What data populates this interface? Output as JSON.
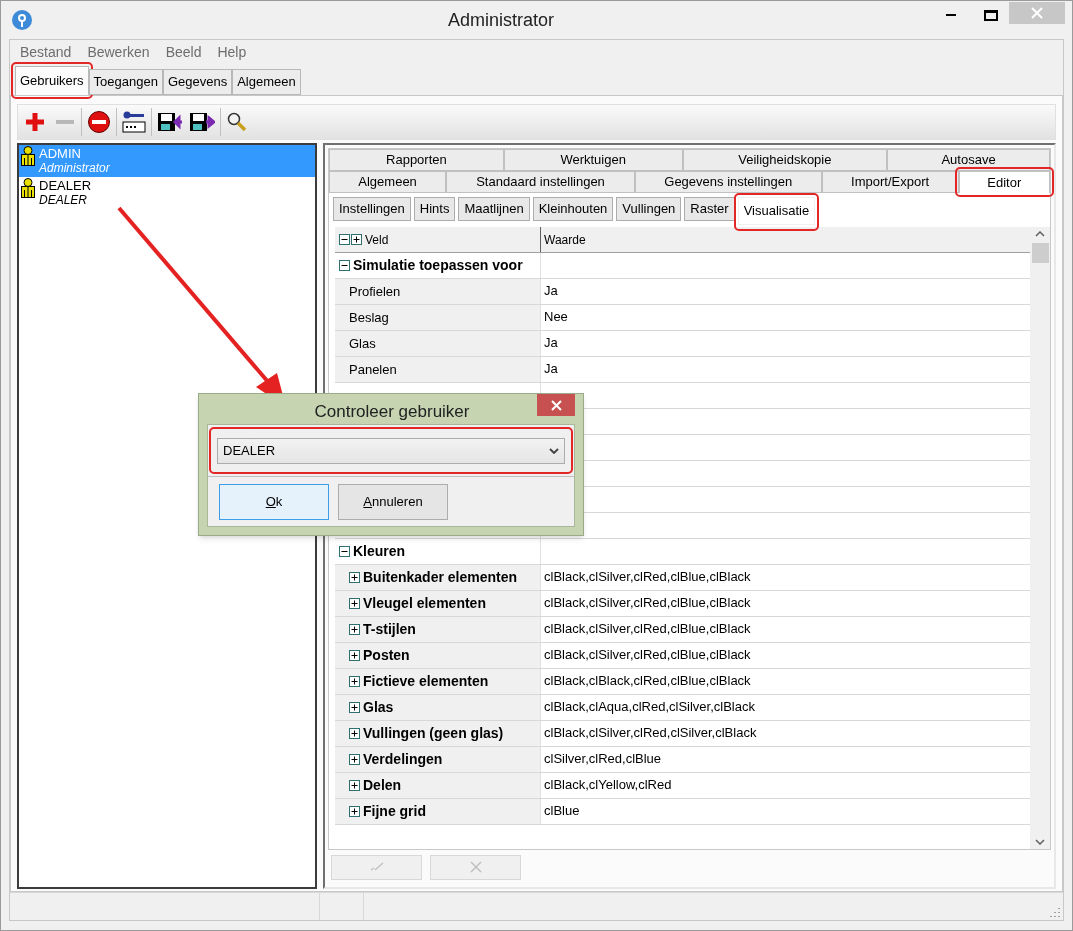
{
  "window": {
    "title": "Administrator"
  },
  "menu": [
    "Bestand",
    "Bewerken",
    "Beeld",
    "Help"
  ],
  "main_tabs": [
    {
      "label": "Gebruikers",
      "selected": true,
      "highlighted": true
    },
    {
      "label": "Toegangen",
      "selected": false,
      "highlighted": false
    },
    {
      "label": "Gegevens",
      "selected": false,
      "highlighted": false
    },
    {
      "label": "Algemeen",
      "selected": false,
      "highlighted": false
    }
  ],
  "users": [
    {
      "name": "ADMIN",
      "role": "Administrator",
      "selected": true
    },
    {
      "name": "DEALER",
      "role": "DEALER",
      "selected": false
    }
  ],
  "settings_tabs": [
    [
      {
        "label": "Rapporten",
        "selected": false,
        "highlighted": false
      },
      {
        "label": "Werktuigen",
        "selected": false,
        "highlighted": false
      },
      {
        "label": "Veiligheidskopie",
        "selected": false,
        "highlighted": false
      },
      {
        "label": "Autosave",
        "selected": false,
        "highlighted": false
      }
    ],
    [
      {
        "label": "Algemeen",
        "selected": false,
        "highlighted": false
      },
      {
        "label": "Standaard instellingen",
        "selected": false,
        "highlighted": false
      },
      {
        "label": "Gegevens instellingen",
        "selected": false,
        "highlighted": false
      },
      {
        "label": "Import/Export",
        "selected": false,
        "highlighted": false
      },
      {
        "label": "Editor",
        "selected": true,
        "highlighted": true
      }
    ]
  ],
  "sub_tabs": [
    {
      "label": "Instellingen",
      "selected": false,
      "highlighted": false
    },
    {
      "label": "Hints",
      "selected": false,
      "highlighted": false
    },
    {
      "label": "Maatlijnen",
      "selected": false,
      "highlighted": false
    },
    {
      "label": "Kleinhouten",
      "selected": false,
      "highlighted": false
    },
    {
      "label": "Vullingen",
      "selected": false,
      "highlighted": false
    },
    {
      "label": "Raster",
      "selected": false,
      "highlighted": false
    },
    {
      "label": "Visualisatie",
      "selected": true,
      "highlighted": true
    }
  ],
  "grid": {
    "columns": [
      "Veld",
      "Waarde"
    ],
    "rows": [
      {
        "kind": "group",
        "label": "Simulatie toepassen voor",
        "expanded": true
      },
      {
        "kind": "item",
        "label": "Profielen",
        "value": "Ja"
      },
      {
        "kind": "item",
        "label": "Beslag",
        "value": "Nee"
      },
      {
        "kind": "item",
        "label": "Glas",
        "value": "Ja"
      },
      {
        "kind": "item",
        "label": "Panelen",
        "value": "Ja"
      },
      {
        "kind": "blank"
      },
      {
        "kind": "blank"
      },
      {
        "kind": "blank"
      },
      {
        "kind": "blank"
      },
      {
        "kind": "blank"
      },
      {
        "kind": "blank"
      },
      {
        "kind": "group",
        "label": "Kleuren",
        "expanded": true
      },
      {
        "kind": "subgroup",
        "label": "Buitenkader elementen",
        "value": "clBlack,clSilver,clRed,clBlue,clBlack",
        "expanded": false
      },
      {
        "kind": "subgroup",
        "label": "Vleugel elementen",
        "value": "clBlack,clSilver,clRed,clBlue,clBlack",
        "expanded": false
      },
      {
        "kind": "subgroup",
        "label": "T-stijlen",
        "value": "clBlack,clSilver,clRed,clBlue,clBlack",
        "expanded": false
      },
      {
        "kind": "subgroup",
        "label": "Posten",
        "value": "clBlack,clSilver,clRed,clBlue,clBlack",
        "expanded": false
      },
      {
        "kind": "subgroup",
        "label": "Fictieve elementen",
        "value": "clBlack,clBlack,clRed,clBlue,clBlack",
        "expanded": false
      },
      {
        "kind": "subgroup",
        "label": "Glas",
        "value": "clBlack,clAqua,clRed,clSilver,clBlack",
        "expanded": false
      },
      {
        "kind": "subgroup",
        "label": "Vullingen (geen glas)",
        "value": "clBlack,clSilver,clRed,clSilver,clBlack",
        "expanded": false
      },
      {
        "kind": "subgroup",
        "label": "Verdelingen",
        "value": "clSilver,clRed,clBlue",
        "expanded": false
      },
      {
        "kind": "subgroup",
        "label": "Delen",
        "value": "clBlack,clYellow,clRed",
        "expanded": false
      },
      {
        "kind": "subgroup",
        "label": "Fijne grid",
        "value": "clBlue",
        "expanded": false
      }
    ]
  },
  "grid_buttons": [
    {
      "kind": "confirm",
      "disabled": true
    },
    {
      "kind": "cancel",
      "disabled": true
    }
  ],
  "dialog": {
    "title": "Controleer gebruiker",
    "select": {
      "value": "DEALER",
      "highlighted": true
    },
    "buttons": [
      {
        "label": "Ok",
        "focused": true
      },
      {
        "label": "Annuleren",
        "focused": false
      }
    ]
  },
  "pointer_arrow": true
}
